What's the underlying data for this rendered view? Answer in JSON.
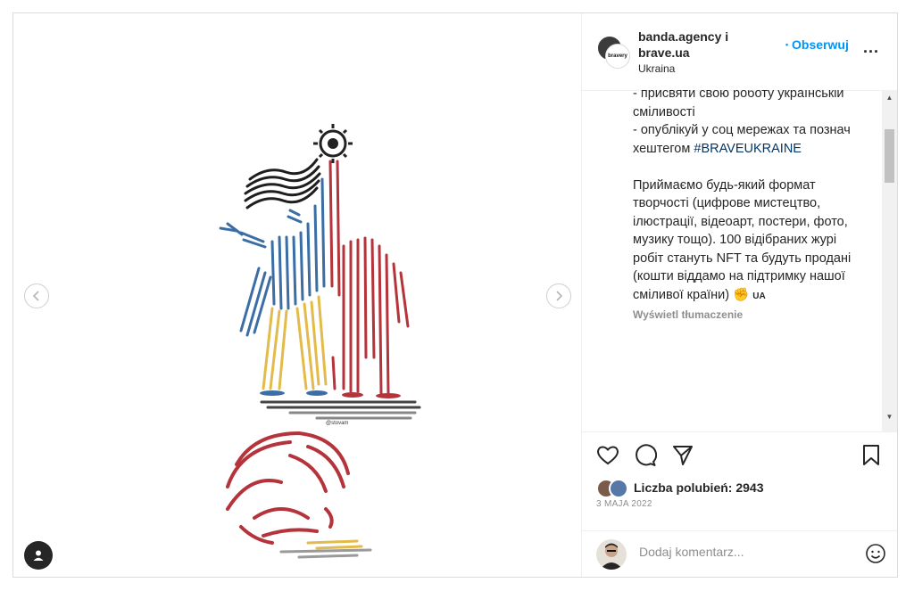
{
  "header": {
    "username_line1": "banda.agency i",
    "username_line2": "brave.ua",
    "location": "Ukraina",
    "follow_label": "Obserwuj",
    "more_label": "...",
    "avatar_text": "bravery"
  },
  "caption": {
    "lines": [
      "- присвяти свою роботу українській сміливості",
      "- опублікуй у соц мережах та познач хештегом",
      "Приймаємо будь-який формат творчості (цифрове мистецтво, ілюстрації, відеоарт, постери, фото, музику тощо). 100 відібраних журі робіт стануть NFT та будуть продані (кошти віддамо на підтримку нашої сміливої країни)"
    ],
    "hashtag": "#BRAVEUKRAINE",
    "emoji": "✊",
    "country_code": "UA",
    "translate_label": "Wyświetl tłumaczenie"
  },
  "likes": {
    "text": "Liczba polubień: 2943"
  },
  "date": "3 MAJA 2022",
  "comment": {
    "placeholder": "Dodaj komentarz..."
  },
  "media": {
    "signature": "@stovam"
  },
  "colors": {
    "blue": "#3a6ea5",
    "yellow": "#e2bb4a",
    "red": "#b5333b",
    "accent": "#0095f6"
  },
  "icons": [
    "chevron-left-icon",
    "chevron-right-icon",
    "user-tag-icon",
    "heart-icon",
    "comment-icon",
    "share-icon",
    "bookmark-icon",
    "emoji-icon"
  ]
}
